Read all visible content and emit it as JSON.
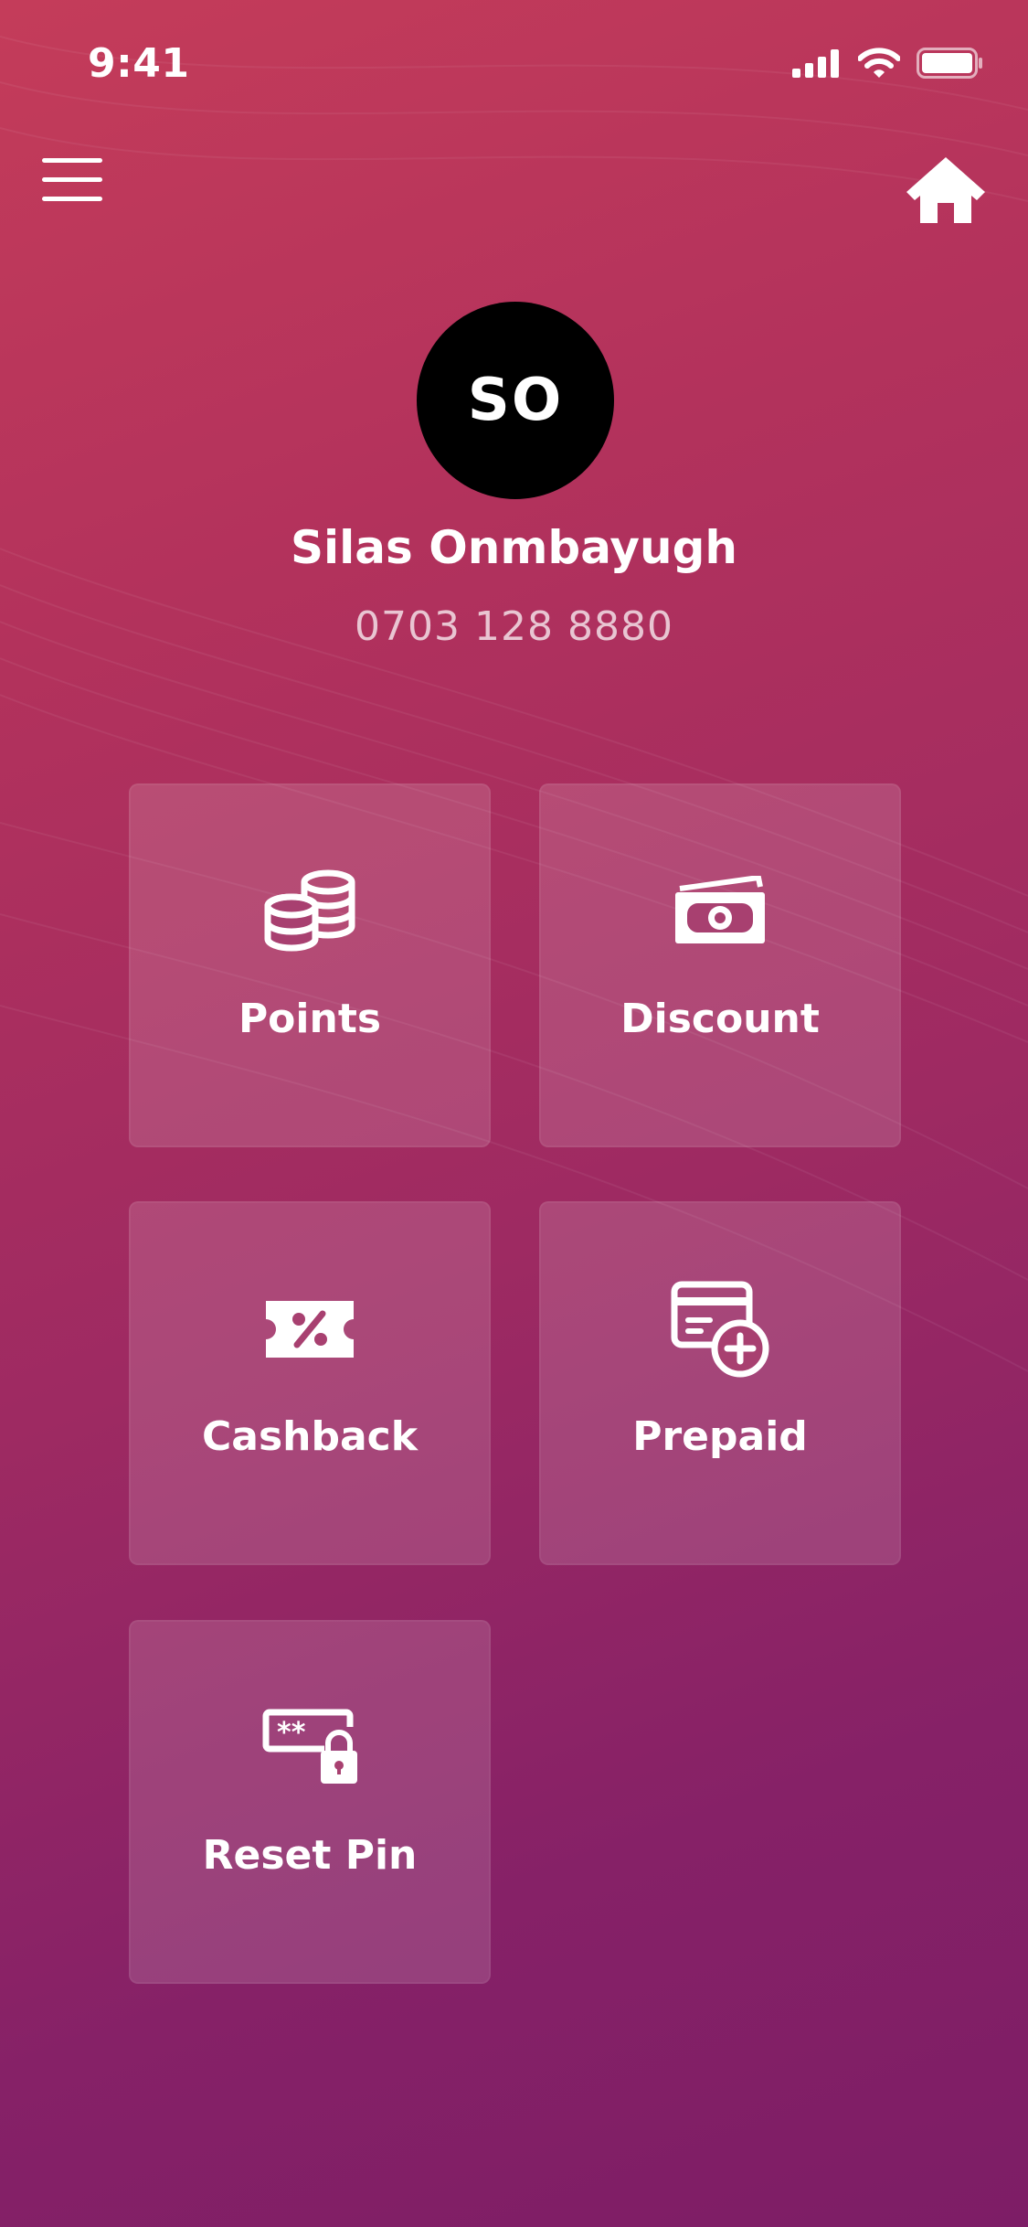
{
  "status_bar": {
    "time": "9:41",
    "icons": [
      "cellular-signal-icon",
      "wifi-icon",
      "battery-icon"
    ]
  },
  "nav": {
    "menu_icon": "hamburger-menu-icon",
    "home_icon": "home-icon"
  },
  "profile": {
    "initials": "SO",
    "name": "Silas Onmbayugh",
    "phone": "0703 128 8880"
  },
  "tiles": [
    {
      "label": "Points",
      "icon": "coins-icon"
    },
    {
      "label": "Discount",
      "icon": "money-bill-icon"
    },
    {
      "label": "Cashback",
      "icon": "percent-ticket-icon"
    },
    {
      "label": "Prepaid",
      "icon": "card-add-icon"
    },
    {
      "label": "Reset Pin",
      "icon": "pin-lock-icon"
    }
  ],
  "colors": {
    "gradient_top": "#c43c5a",
    "gradient_bottom": "#7d1d66",
    "avatar_bg": "#000000",
    "text": "#ffffff"
  }
}
